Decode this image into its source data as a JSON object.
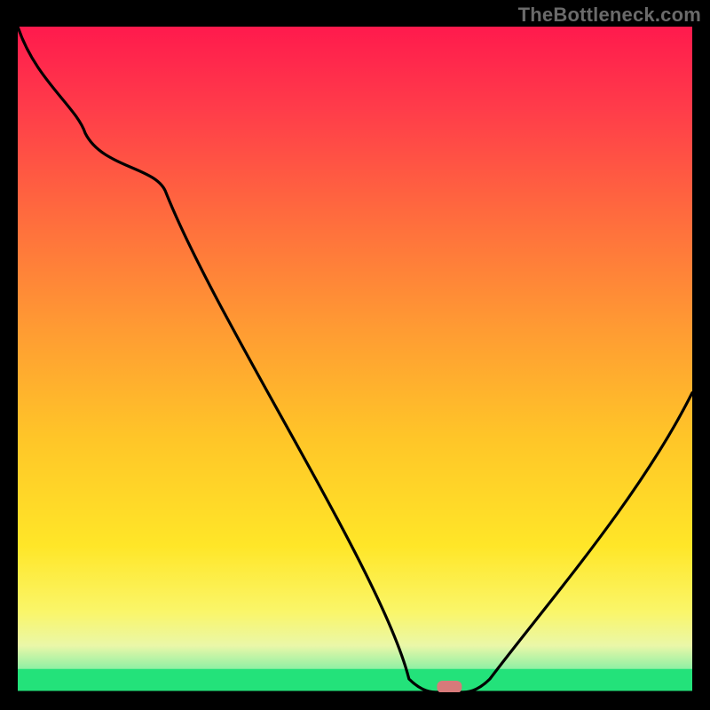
{
  "watermark": "TheBottleneck.com",
  "chart_data": {
    "type": "line",
    "title": "",
    "xlabel": "",
    "ylabel": "",
    "xlim": [
      0,
      100
    ],
    "ylim": [
      0,
      100
    ],
    "grid": false,
    "series": [
      {
        "name": "curve",
        "x": [
          0,
          10,
          22,
          58,
          62,
          66,
          70,
          100
        ],
        "values": [
          100,
          84,
          75,
          2,
          0,
          0,
          2,
          45
        ]
      }
    ],
    "marker": {
      "x": 64,
      "y": 0.8,
      "color": "#d77a7a"
    },
    "green_band": {
      "y0": 0,
      "y1": 3.5
    },
    "gradient_stops": [
      {
        "offset": 0.0,
        "color": "#ff1a4d"
      },
      {
        "offset": 0.12,
        "color": "#ff3b4a"
      },
      {
        "offset": 0.28,
        "color": "#ff6a3e"
      },
      {
        "offset": 0.45,
        "color": "#ff9a33"
      },
      {
        "offset": 0.62,
        "color": "#ffc628"
      },
      {
        "offset": 0.78,
        "color": "#ffe628"
      },
      {
        "offset": 0.88,
        "color": "#faf66a"
      },
      {
        "offset": 0.93,
        "color": "#eaf7a8"
      },
      {
        "offset": 0.965,
        "color": "#8ff0a4"
      },
      {
        "offset": 1.0,
        "color": "#23e27a"
      }
    ]
  }
}
